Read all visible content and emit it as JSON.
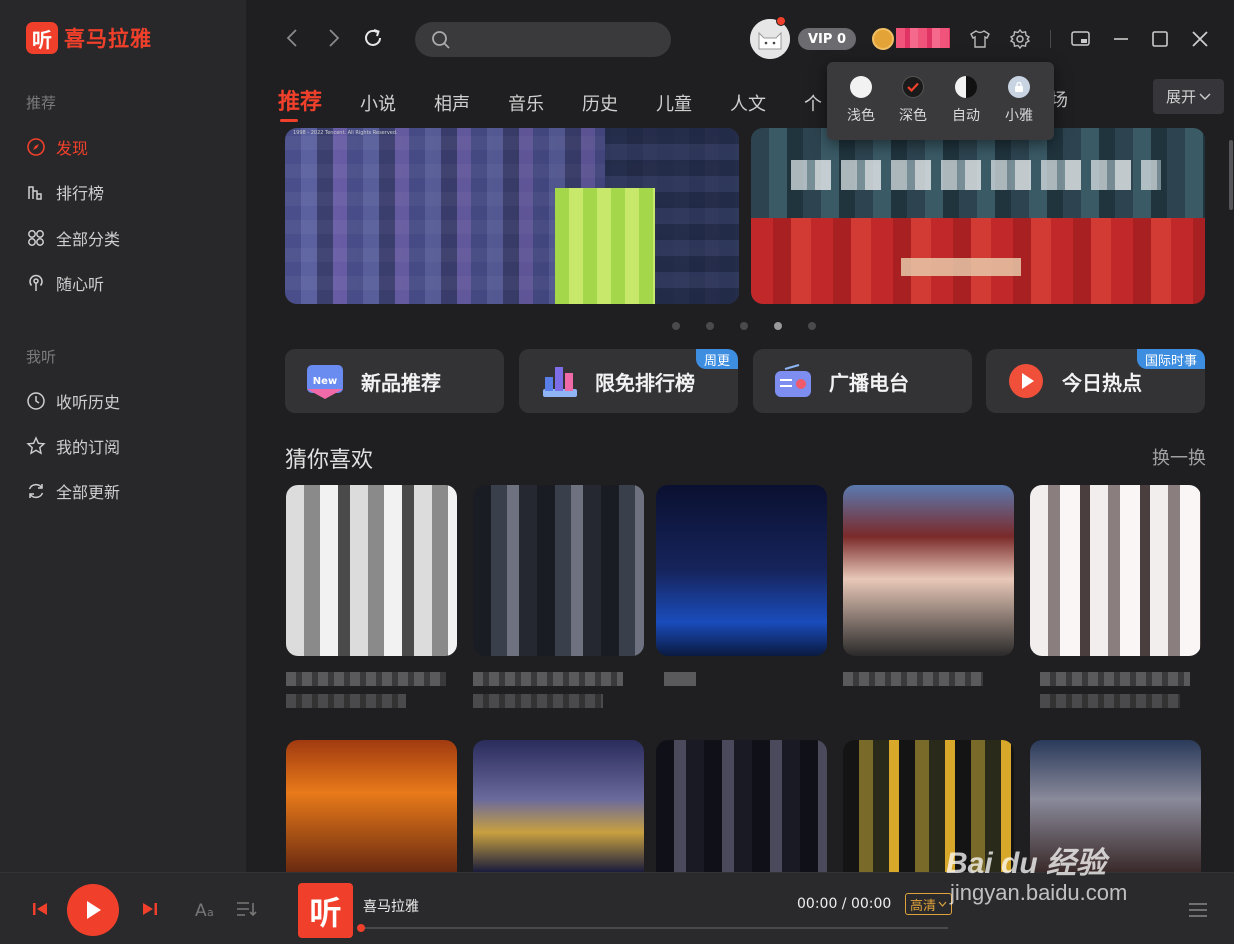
{
  "app": {
    "logo_char": "听",
    "name": "喜马拉雅"
  },
  "sidebar": {
    "group1": "推荐",
    "group2": "我听",
    "items": [
      {
        "label": "发现",
        "icon": "compass-icon",
        "active": true
      },
      {
        "label": "排行榜",
        "icon": "bar-chart-icon"
      },
      {
        "label": "全部分类",
        "icon": "grid-icon"
      },
      {
        "label": "随心听",
        "icon": "broadcast-icon"
      },
      {
        "label": "收听历史",
        "icon": "clock-icon"
      },
      {
        "label": "我的订阅",
        "icon": "star-icon"
      },
      {
        "label": "全部更新",
        "icon": "refresh-icon"
      }
    ]
  },
  "topbar": {
    "search_placeholder": "",
    "vip_label": "VIP 0"
  },
  "theme_menu": {
    "options": [
      {
        "label": "浅色"
      },
      {
        "label": "深色",
        "selected": true
      },
      {
        "label": "自动"
      },
      {
        "label": "小雅"
      }
    ]
  },
  "tabs": [
    "推荐",
    "小说",
    "相声",
    "音乐",
    "历史",
    "儿童",
    "人文",
    "个"
  ],
  "tab_tail": "场",
  "expand_label": "展开",
  "banner_caption": "1998 - 2022 Tencent. All Rights Reserved.",
  "quick_entries": [
    {
      "label": "新品推荐",
      "icon": "new-badge-icon",
      "tag": ""
    },
    {
      "label": "限免排行榜",
      "icon": "ranking-icon",
      "tag": "周更"
    },
    {
      "label": "广播电台",
      "icon": "radio-icon",
      "tag": ""
    },
    {
      "label": "今日热点",
      "icon": "play-circle-icon",
      "tag": "国际时事"
    }
  ],
  "section": {
    "title": "猜你喜欢",
    "more": "换一换"
  },
  "player": {
    "cover_char": "听",
    "track_title": "喜马拉雅",
    "time": "00:00 / 00:00",
    "quality": "高清",
    "progress": 0
  },
  "watermark": {
    "brand": "Bai du 经验",
    "url": "jingyan.baidu.com"
  },
  "colors": {
    "accent": "#f0402b",
    "background": "#1f1f21",
    "sidebar": "#28282a"
  }
}
